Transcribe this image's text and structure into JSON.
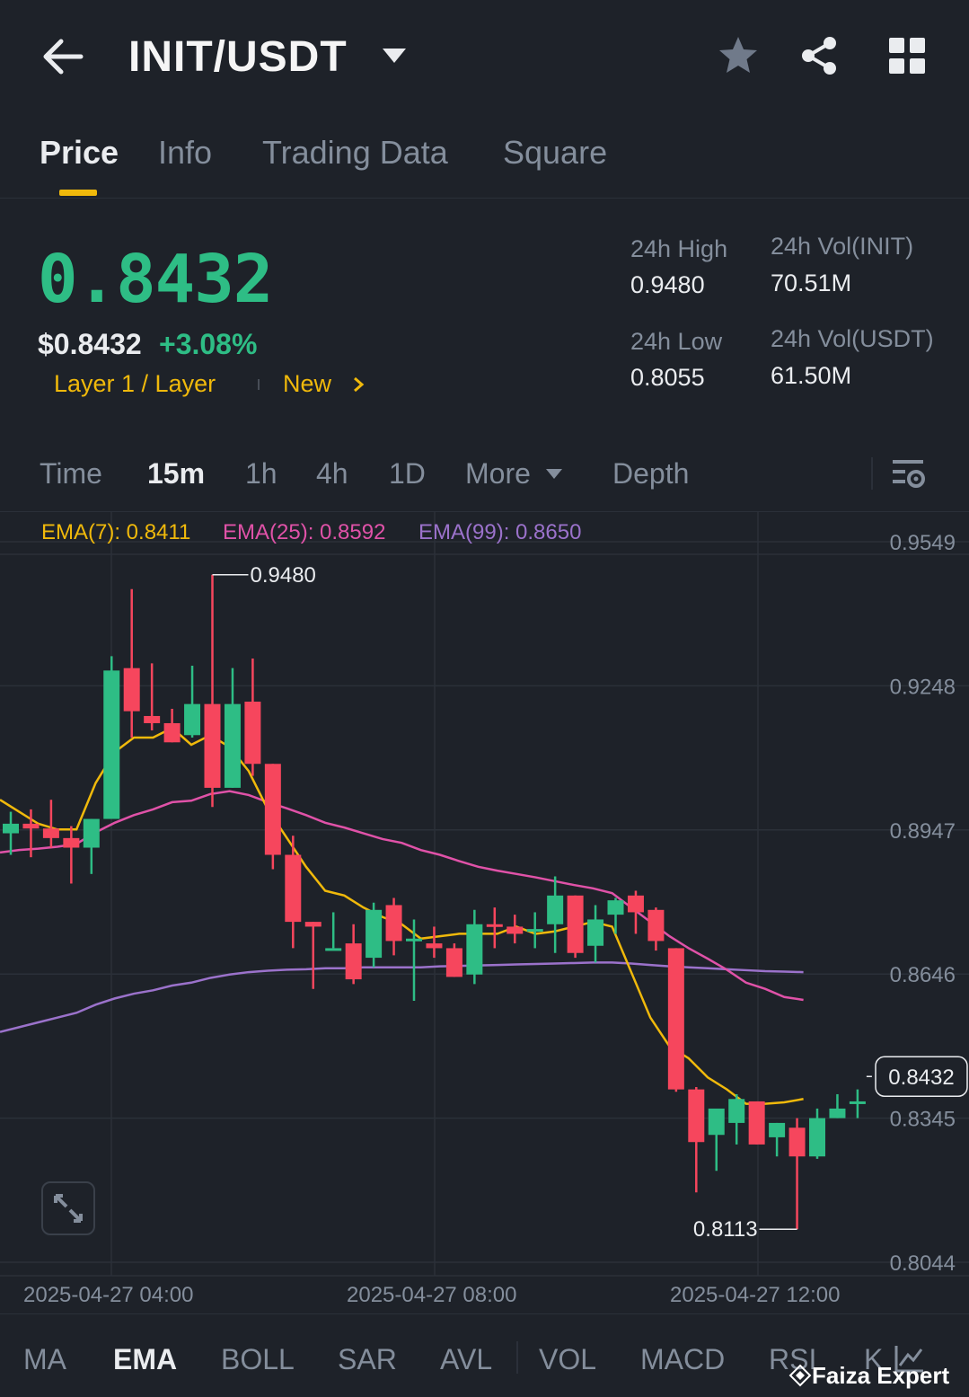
{
  "header": {
    "pair": "INIT/USDT",
    "icons": [
      "back-arrow-icon",
      "caret-down-icon",
      "star-icon",
      "share-icon",
      "grid-icon"
    ]
  },
  "tabs": [
    {
      "label": "Price",
      "active": true
    },
    {
      "label": "Info",
      "active": false
    },
    {
      "label": "Trading Data",
      "active": false
    },
    {
      "label": "Square",
      "active": false
    }
  ],
  "ticker": {
    "last_price": "0.8432",
    "usd_price": "$0.8432",
    "change_pct": "+3.08%",
    "tag_category": "Layer 1 / Layer",
    "tag_new": "New",
    "high_label": "24h High",
    "high_value": "0.9480",
    "low_label": "24h Low",
    "low_value": "0.8055",
    "vol_base_label": "24h Vol(INIT)",
    "vol_base_value": "70.51M",
    "vol_quote_label": "24h Vol(USDT)",
    "vol_quote_value": "61.50M"
  },
  "intervals": {
    "items": [
      "Time",
      "15m",
      "1h",
      "4h",
      "1D",
      "More"
    ],
    "active": "15m",
    "depth": "Depth"
  },
  "ema": {
    "ema7": "EMA(7): 0.8411",
    "ema25": "EMA(25): 0.8592",
    "ema99": "EMA(99): 0.8650",
    "colors": {
      "ema7": "#f0b90b",
      "ema25": "#e052a8",
      "ema99": "#9b72cb"
    }
  },
  "chart_data": {
    "type": "candlestick",
    "y_ticks": [
      "0.9549",
      "0.9248",
      "0.8947",
      "0.8646",
      "0.8345",
      "0.8044"
    ],
    "ylim": [
      0.8044,
      0.9549
    ],
    "x_ticks": [
      "2025-04-27 04:00",
      "2025-04-27 08:00",
      "2025-04-27 12:00"
    ],
    "high_marker": "0.9480",
    "low_marker": "0.8113",
    "last_price_label": "0.8432",
    "colors": {
      "up": "#2ebd85",
      "down": "#f6465d",
      "grid": "#2b3039"
    },
    "candles": [
      {
        "o": 0.894,
        "h": 0.8985,
        "l": 0.8895,
        "c": 0.896
      },
      {
        "o": 0.896,
        "h": 0.899,
        "l": 0.889,
        "c": 0.895
      },
      {
        "o": 0.895,
        "h": 0.901,
        "l": 0.891,
        "c": 0.893
      },
      {
        "o": 0.893,
        "h": 0.8955,
        "l": 0.8835,
        "c": 0.891
      },
      {
        "o": 0.891,
        "h": 0.8945,
        "l": 0.8855,
        "c": 0.897
      },
      {
        "o": 0.897,
        "h": 0.931,
        "l": 0.897,
        "c": 0.928
      },
      {
        "o": 0.9285,
        "h": 0.945,
        "l": 0.914,
        "c": 0.9195
      },
      {
        "o": 0.9185,
        "h": 0.9295,
        "l": 0.9155,
        "c": 0.917
      },
      {
        "o": 0.917,
        "h": 0.92,
        "l": 0.913,
        "c": 0.913
      },
      {
        "o": 0.9145,
        "h": 0.929,
        "l": 0.914,
        "c": 0.921
      },
      {
        "o": 0.921,
        "h": 0.948,
        "l": 0.8995,
        "c": 0.9035
      },
      {
        "o": 0.9035,
        "h": 0.9285,
        "l": 0.9035,
        "c": 0.921
      },
      {
        "o": 0.9215,
        "h": 0.9305,
        "l": 0.906,
        "c": 0.9085
      },
      {
        "o": 0.9085,
        "h": 0.9085,
        "l": 0.8865,
        "c": 0.8895
      },
      {
        "o": 0.8895,
        "h": 0.8935,
        "l": 0.87,
        "c": 0.8755
      },
      {
        "o": 0.8755,
        "h": 0.8735,
        "l": 0.8615,
        "c": 0.8745
      },
      {
        "o": 0.87,
        "h": 0.8775,
        "l": 0.877,
        "c": 0.87
      },
      {
        "o": 0.871,
        "h": 0.875,
        "l": 0.8625,
        "c": 0.8635
      },
      {
        "o": 0.868,
        "h": 0.8795,
        "l": 0.866,
        "c": 0.878
      },
      {
        "o": 0.879,
        "h": 0.8805,
        "l": 0.8685,
        "c": 0.8715
      },
      {
        "o": 0.8715,
        "h": 0.876,
        "l": 0.859,
        "c": 0.872
      },
      {
        "o": 0.871,
        "h": 0.8745,
        "l": 0.868,
        "c": 0.87
      },
      {
        "o": 0.87,
        "h": 0.871,
        "l": 0.864,
        "c": 0.864
      },
      {
        "o": 0.8645,
        "h": 0.878,
        "l": 0.8625,
        "c": 0.875
      },
      {
        "o": 0.875,
        "h": 0.8785,
        "l": 0.87,
        "c": 0.8745
      },
      {
        "o": 0.8745,
        "h": 0.877,
        "l": 0.871,
        "c": 0.873
      },
      {
        "o": 0.874,
        "h": 0.8775,
        "l": 0.87,
        "c": 0.874
      },
      {
        "o": 0.875,
        "h": 0.885,
        "l": 0.869,
        "c": 0.881
      },
      {
        "o": 0.881,
        "h": 0.881,
        "l": 0.868,
        "c": 0.869
      },
      {
        "o": 0.8705,
        "h": 0.879,
        "l": 0.867,
        "c": 0.876
      },
      {
        "o": 0.877,
        "h": 0.8805,
        "l": 0.873,
        "c": 0.88
      },
      {
        "o": 0.881,
        "h": 0.882,
        "l": 0.873,
        "c": 0.8775
      },
      {
        "o": 0.878,
        "h": 0.8785,
        "l": 0.8695,
        "c": 0.8715
      },
      {
        "o": 0.87,
        "h": 0.8685,
        "l": 0.84,
        "c": 0.8405
      },
      {
        "o": 0.8405,
        "h": 0.841,
        "l": 0.819,
        "c": 0.8295
      },
      {
        "o": 0.831,
        "h": 0.8355,
        "l": 0.8235,
        "c": 0.8365
      },
      {
        "o": 0.8335,
        "h": 0.8395,
        "l": 0.829,
        "c": 0.8385
      },
      {
        "o": 0.838,
        "h": 0.8375,
        "l": 0.829,
        "c": 0.829
      },
      {
        "o": 0.8305,
        "h": 0.8335,
        "l": 0.8265,
        "c": 0.8335
      },
      {
        "o": 0.8325,
        "h": 0.8345,
        "l": 0.8113,
        "c": 0.8265
      },
      {
        "o": 0.8265,
        "h": 0.8365,
        "l": 0.826,
        "c": 0.8345
      },
      {
        "o": 0.8345,
        "h": 0.8395,
        "l": 0.835,
        "c": 0.8365
      },
      {
        "o": 0.8375,
        "h": 0.8405,
        "l": 0.8345,
        "c": 0.838
      }
    ],
    "ema7_line": [
      0.901,
      0.8985,
      0.896,
      0.8948,
      0.8948,
      0.9045,
      0.911,
      0.914,
      0.914,
      0.916,
      0.9125,
      0.9145,
      0.912,
      0.907,
      0.899,
      0.893,
      0.887,
      0.882,
      0.881,
      0.8785,
      0.8765,
      0.875,
      0.872,
      0.8725,
      0.873,
      0.873,
      0.873,
      0.8745,
      0.873,
      0.8735,
      0.8745,
      0.8755,
      0.8745,
      0.865,
      0.8555,
      0.8495,
      0.847,
      0.843,
      0.8405,
      0.8375,
      0.8375,
      0.8378,
      0.8385
    ],
    "ema25_line": [
      0.89,
      0.8905,
      0.8908,
      0.8912,
      0.8918,
      0.8942,
      0.8962,
      0.8978,
      0.899,
      0.9005,
      0.9008,
      0.9022,
      0.9028,
      0.902,
      0.9005,
      0.8992,
      0.8978,
      0.8962,
      0.8952,
      0.894,
      0.8928,
      0.892,
      0.8905,
      0.8895,
      0.8882,
      0.887,
      0.8862,
      0.8855,
      0.8848,
      0.884,
      0.8832,
      0.8825,
      0.8815,
      0.8785,
      0.8755,
      0.8725,
      0.87,
      0.8678,
      0.8655,
      0.8628,
      0.8615,
      0.8598,
      0.8592
    ],
    "ema99_line": [
      0.8525,
      0.8535,
      0.8545,
      0.8555,
      0.8565,
      0.8582,
      0.8595,
      0.8605,
      0.8612,
      0.8622,
      0.8628,
      0.8638,
      0.8645,
      0.865,
      0.8653,
      0.8655,
      0.8656,
      0.8658,
      0.8658,
      0.866,
      0.866,
      0.866,
      0.866,
      0.8662,
      0.8663,
      0.8664,
      0.8665,
      0.8666,
      0.8667,
      0.8668,
      0.8669,
      0.867,
      0.867,
      0.8668,
      0.8665,
      0.8662,
      0.866,
      0.8658,
      0.8656,
      0.8654,
      0.8652,
      0.8651,
      0.865
    ]
  },
  "bottom_indicators": {
    "items": [
      "MA",
      "EMA",
      "BOLL",
      "SAR",
      "AVL",
      "VOL",
      "MACD",
      "RSI",
      "K"
    ],
    "active": "EMA"
  },
  "watermark": "Faiza Expert"
}
